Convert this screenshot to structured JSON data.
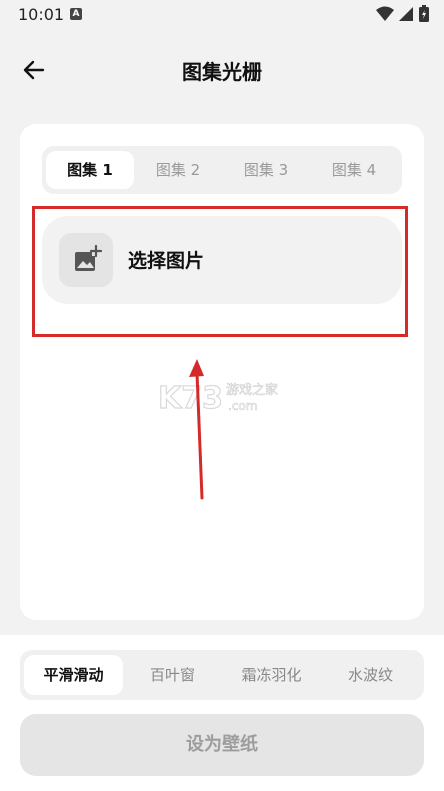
{
  "status_bar": {
    "time": "10:01",
    "notification_badge": "A"
  },
  "header": {
    "title": "图集光栅"
  },
  "gallery_tabs": [
    "图集 1",
    "图集 2",
    "图集 3",
    "图集 4"
  ],
  "picker": {
    "label": "选择图片"
  },
  "effect_tabs": [
    "平滑滑动",
    "百叶窗",
    "霜冻羽化",
    "水波纹"
  ],
  "set_wallpaper_button": "设为壁纸",
  "watermark": {
    "text": "游戏之家",
    "sub": ".com",
    "logo": "K73"
  },
  "colors": {
    "highlight": "#d42a2a",
    "background": "#f2f2f2",
    "card": "#ffffff"
  }
}
